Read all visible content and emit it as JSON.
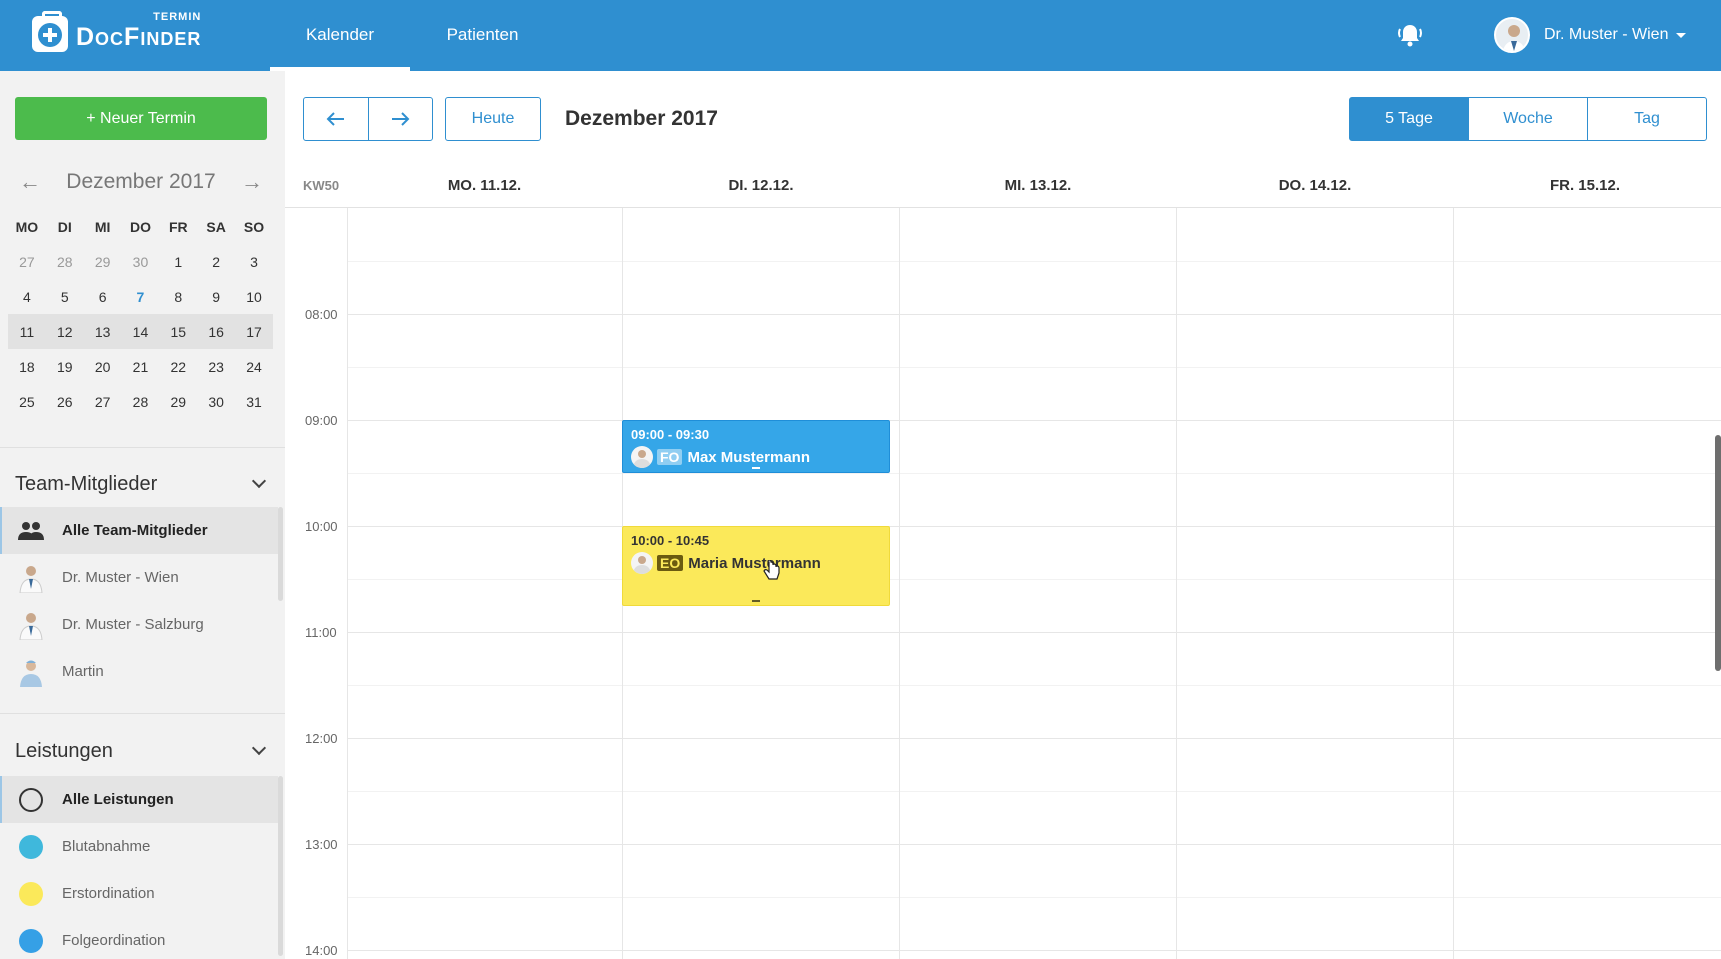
{
  "app": {
    "logo_superscript": "TERMIN",
    "logo_text": "DocFinder",
    "nav_tabs": [
      {
        "label": "Kalender",
        "active": true
      },
      {
        "label": "Patienten",
        "active": false
      }
    ],
    "user_name": "Dr. Muster - Wien",
    "icons": {
      "bell": "bell-icon",
      "caret": "caret-down-icon"
    },
    "brand_color": "#2f8fd0"
  },
  "sidebar": {
    "new_appointment_label": "+ Neuer Termin",
    "mini_calendar": {
      "month_title": "Dezember 2017",
      "weekdays": [
        "MO",
        "DI",
        "MI",
        "DO",
        "FR",
        "SA",
        "SO"
      ],
      "weeks": [
        [
          "27",
          "28",
          "29",
          "30",
          "1",
          "2",
          "3"
        ],
        [
          "4",
          "5",
          "6",
          "7",
          "8",
          "9",
          "10"
        ],
        [
          "11",
          "12",
          "13",
          "14",
          "15",
          "16",
          "17"
        ],
        [
          "18",
          "19",
          "20",
          "21",
          "22",
          "23",
          "24"
        ],
        [
          "25",
          "26",
          "27",
          "28",
          "29",
          "30",
          "31"
        ]
      ],
      "highlighted_week_index": 2,
      "today": "7"
    },
    "team": {
      "title": "Team-Mitglieder",
      "items": [
        {
          "label": "Alle Team-Mitglieder",
          "active": true
        },
        {
          "label": "Dr. Muster - Wien",
          "active": false
        },
        {
          "label": "Dr. Muster - Salzburg",
          "active": false
        },
        {
          "label": "Martin",
          "active": false
        }
      ]
    },
    "services": {
      "title": "Leistungen",
      "items": [
        {
          "label": "Alle Leistungen",
          "active": true,
          "color": ""
        },
        {
          "label": "Blutabnahme",
          "active": false,
          "color": "#3fb8dc"
        },
        {
          "label": "Erstordination",
          "active": false,
          "color": "#fbe95a"
        },
        {
          "label": "Folgeordination",
          "active": false,
          "color": "#35a0e6"
        }
      ]
    }
  },
  "calendar": {
    "title": "Dezember 2017",
    "today_label": "Heute",
    "views": [
      {
        "label": "5 Tage",
        "active": true
      },
      {
        "label": "Woche",
        "active": false
      },
      {
        "label": "Tag",
        "active": false
      }
    ],
    "week_label": "KW50",
    "days": [
      "MO. 11.12.",
      "DI. 12.12.",
      "MI. 13.12.",
      "DO. 14.12.",
      "FR. 15.12."
    ],
    "hours": [
      "08:00",
      "09:00",
      "10:00",
      "11:00",
      "12:00",
      "13:00",
      "14:00"
    ],
    "events": [
      {
        "time": "09:00 - 09:30",
        "tag": "FO",
        "name": "Max Mustermann",
        "color": "blue",
        "day": 1
      },
      {
        "time": "10:00 - 10:45",
        "tag": "EO",
        "name": "Maria Mustermann",
        "color": "yellow",
        "day": 1
      }
    ]
  }
}
